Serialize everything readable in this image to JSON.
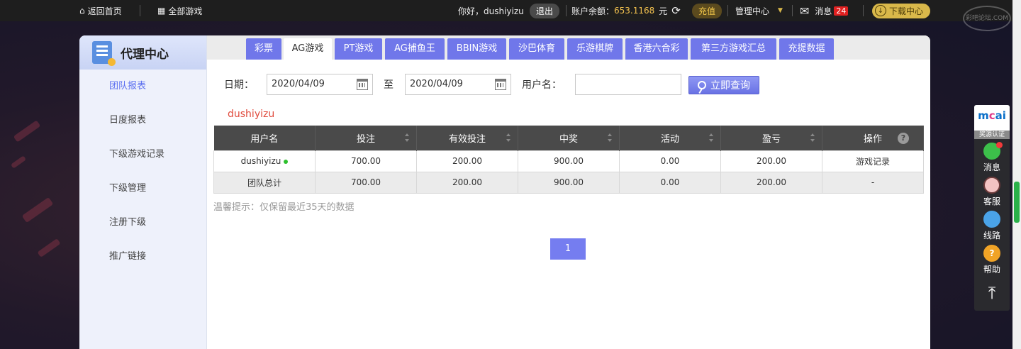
{
  "topbar": {
    "home": "返回首页",
    "all_games": "全部游戏",
    "greeting": "你好，dushiyizu",
    "logout": "退出",
    "balance_label": "账户余额：",
    "balance_value": "653.1168",
    "currency": "元",
    "recharge": "充值",
    "manage": "管理中心",
    "messages": "消息",
    "messages_count": "24",
    "download": "下载中心"
  },
  "watermark": "彩吧论坛.COM",
  "sidebar": {
    "title": "代理中心",
    "items": [
      {
        "label": "团队报表"
      },
      {
        "label": "日度报表"
      },
      {
        "label": "下级游戏记录"
      },
      {
        "label": "下级管理"
      },
      {
        "label": "注册下级"
      },
      {
        "label": "推广链接"
      }
    ]
  },
  "tabs": [
    {
      "label": "彩票"
    },
    {
      "label": "AG游戏"
    },
    {
      "label": "PT游戏"
    },
    {
      "label": "AG捕鱼王"
    },
    {
      "label": "BBIN游戏"
    },
    {
      "label": "沙巴体育"
    },
    {
      "label": "乐游棋牌"
    },
    {
      "label": "香港六合彩"
    },
    {
      "label": "第三方游戏汇总"
    },
    {
      "label": "充提数据"
    }
  ],
  "filter": {
    "date_label": "日期：",
    "start_date": "2020/04/09",
    "to": "至",
    "end_date": "2020/04/09",
    "username_label": "用户名：",
    "username_value": "",
    "query": "立即查询"
  },
  "current_user": "dushiyizu",
  "table": {
    "headers": [
      "用户名",
      "投注",
      "有效投注",
      "中奖",
      "活动",
      "盈亏",
      "操作"
    ],
    "rows": [
      [
        "dushiyizu",
        "700.00",
        "200.00",
        "900.00",
        "0.00",
        "200.00",
        "游戏记录"
      ]
    ],
    "total": [
      "团队总计",
      "700.00",
      "200.00",
      "900.00",
      "0.00",
      "200.00",
      "-"
    ]
  },
  "tip": "温馨提示：仅保留最近35天的数据",
  "pagination": {
    "current": "1"
  },
  "right_bar": {
    "badge_text": "奖源认证",
    "brand": "mcai",
    "items": [
      {
        "label": "消息"
      },
      {
        "label": "客服"
      },
      {
        "label": "线路"
      },
      {
        "label": "帮助"
      }
    ]
  }
}
